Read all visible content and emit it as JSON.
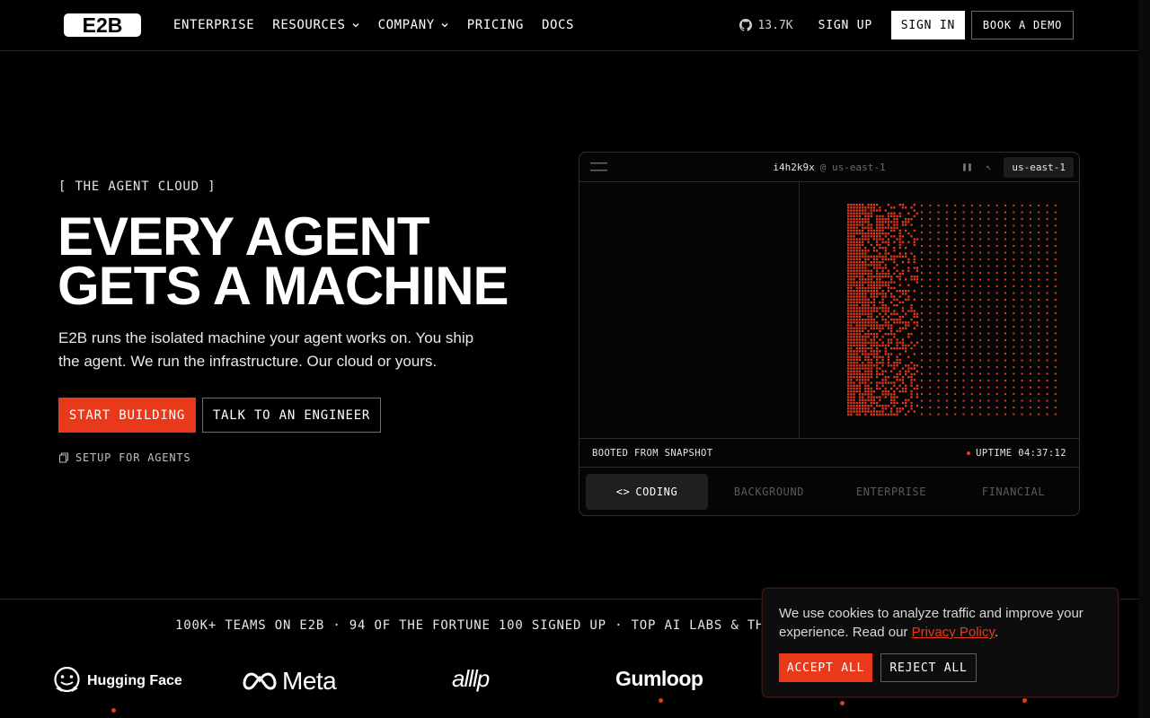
{
  "header": {
    "logo_text": "E2B",
    "nav": [
      {
        "label": "ENTERPRISE",
        "dropdown": false
      },
      {
        "label": "RESOURCES",
        "dropdown": true
      },
      {
        "label": "COMPANY",
        "dropdown": true
      },
      {
        "label": "PRICING",
        "dropdown": false
      },
      {
        "label": "DOCS",
        "dropdown": false
      }
    ],
    "github_stars": "13.7K",
    "sign_up": "SIGN UP",
    "sign_in": "SIGN IN",
    "book_demo": "BOOK A DEMO"
  },
  "hero": {
    "eyebrow": "[ THE AGENT CLOUD ]",
    "headline_1": "EVERY AGENT",
    "headline_2": "GETS A MACHINE",
    "subtext": "E2B runs the isolated machine your agent works on. You ship the agent. We run the infrastructure. Our cloud or yours.",
    "cta_primary": "START BUILDING",
    "cta_secondary": "TALK TO AN ENGINEER",
    "setup_link": "SETUP FOR AGENTS"
  },
  "machine": {
    "host_id": "i4h2k9x",
    "host_region": "@ us-east-1",
    "region_pill": "us-east-1",
    "status_left": "BOOTED FROM SNAPSHOT",
    "uptime": "UPTIME 04:37:12",
    "tabs": [
      {
        "label": "CODING",
        "icon": "code-icon",
        "active": true
      },
      {
        "label": "BACKGROUND",
        "active": false
      },
      {
        "label": "ENTERPRISE",
        "active": false
      },
      {
        "label": "FINANCIAL",
        "active": false
      }
    ],
    "accent": "#e8391a"
  },
  "social_proof": {
    "text": "100K+ TEAMS ON E2B · 94 OF THE FORTUNE 100 SIGNED UP · TOP AI LABS & THE FA",
    "logos": [
      "Hugging Face",
      "Meta",
      "alllp",
      "Gumloop"
    ]
  },
  "cookie": {
    "text_before": "We use cookies to analyze traffic and improve your experience. Read our ",
    "link": "Privacy Policy",
    "text_after": ".",
    "accept": "ACCEPT ALL",
    "reject": "REJECT ALL"
  }
}
